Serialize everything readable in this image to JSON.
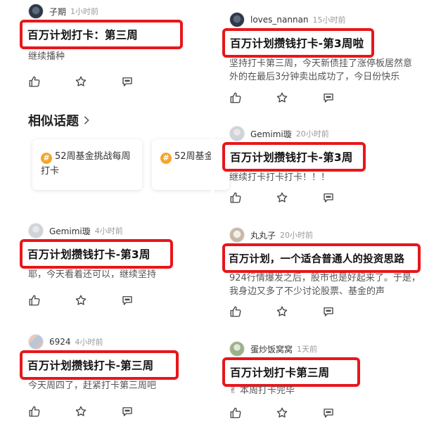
{
  "left": {
    "posts": [
      {
        "author": "子期",
        "time": "1小时前",
        "title": "百万计划打卡：第三周",
        "body": "继续播种"
      },
      {
        "author": "Gemimi璇",
        "time": "4小时前",
        "title": "百万计划攒钱打卡-第3周",
        "body": "耶，今天看着还可以，继续坚持"
      },
      {
        "author": "6924",
        "time": "4小时前",
        "title": "百万计划攒钱打卡-第三周",
        "body": "今天周四了，赶紧打卡第三周吧"
      }
    ],
    "similar_topics": {
      "heading": "相似话题",
      "cards": [
        {
          "hash": "#",
          "label": "52周基金挑战每周打卡"
        },
        {
          "hash": "#",
          "label": "52周基金"
        }
      ]
    }
  },
  "right": {
    "posts": [
      {
        "author": "loves_nannan",
        "time": "15小时前",
        "title": "百万计划攒钱打卡-第3周啦",
        "body": "坚持打卡第三周，今天新债挂了涨停板居然意外的在最后3分钟卖出成功了，今日份快乐"
      },
      {
        "author": "Gemimi璇",
        "time": "20小时前",
        "title": "百万计划攒钱打卡-第3周",
        "body": "继续打卡打卡打卡！！！"
      },
      {
        "author": "丸丸子",
        "time": "20小时前",
        "title": "百万计划，一个适合普通人的投资思路",
        "body": "924行情爆发之后，股市也是好起来了。于是，我身边又多了不少讨论股票、基金的声"
      },
      {
        "author": "蛋炒饭窝窝",
        "time": "1天前",
        "title": "百万计划打卡第三周",
        "body": "✌ 本周打卡完毕"
      }
    ]
  },
  "icons": {
    "like": "thumbs-up-icon",
    "favorite": "star-icon",
    "comment": "comment-icon",
    "chevron": "chevron-right-icon"
  },
  "colors": {
    "highlight_border": "#e8161b",
    "hash_badge": "#f5a623"
  }
}
